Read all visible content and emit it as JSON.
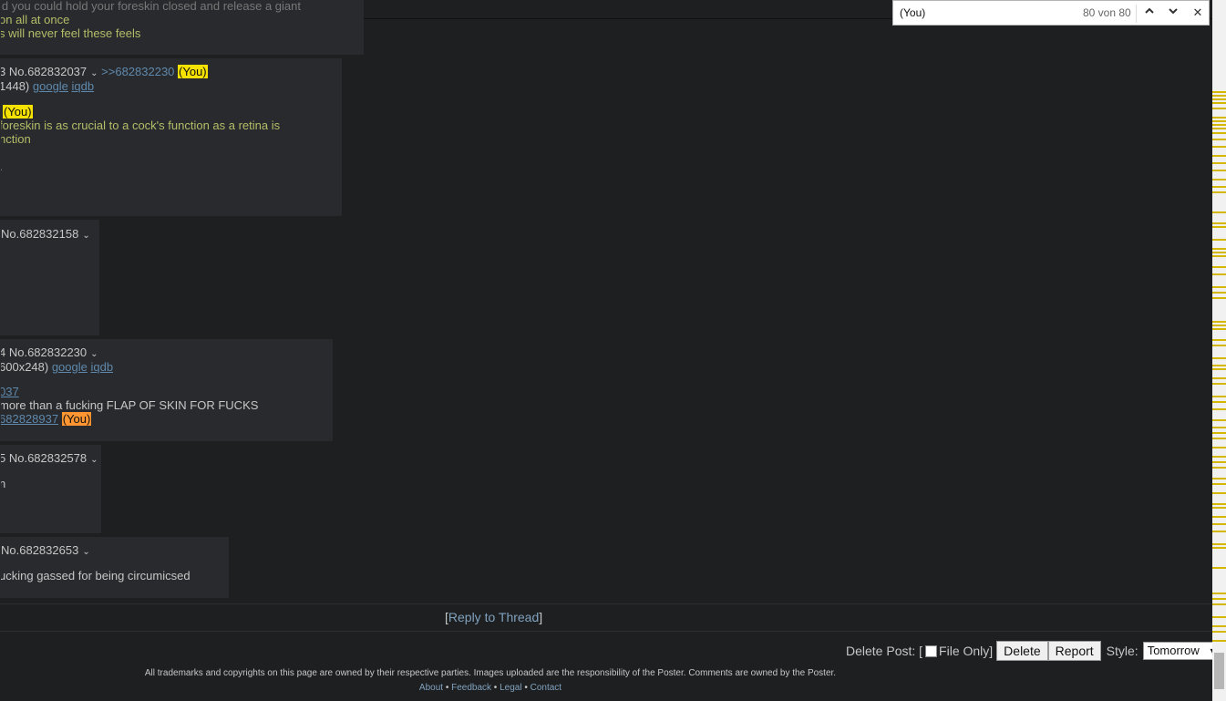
{
  "posts": [
    {
      "lines": [
        {
          "parts": [
            {
              "t": "ld you could hold your foreskin closed and release a giant",
              "c": "faded"
            }
          ]
        },
        {
          "parts": [
            {
              "t": "on all at once",
              "c": "quote"
            }
          ]
        },
        {
          "parts": [
            {
              "t": "s will never feel these feels",
              "c": "quote"
            }
          ]
        }
      ]
    },
    {
      "lines": [
        {
          "parts": [
            {
              "t": "3 No.682832037",
              "c": "num"
            },
            {
              "t": "⌄",
              "c": "arrow"
            },
            {
              "t": " >>682832230 ",
              "c": "ql"
            },
            {
              "t": "(You)",
              "c": "you-hl"
            }
          ]
        },
        {
          "parts": [
            {
              "t": "1448) ",
              "c": ""
            },
            {
              "t": "google",
              "c": "ul"
            },
            {
              "t": " ",
              "c": ""
            },
            {
              "t": "iqdb",
              "c": "ul"
            }
          ]
        },
        {
          "parts": [
            {
              "t": "(You)",
              "c": "you-hl"
            }
          ]
        },
        {
          "parts": [
            {
              "t": " foreskin is as crucial to a cock's function as a retina is",
              "c": "quote"
            }
          ]
        },
        {
          "parts": [
            {
              "t": "nction",
              "c": "quote"
            }
          ]
        },
        {
          "parts": [
            {
              "t": ".",
              "c": ""
            }
          ]
        }
      ]
    },
    {
      "lines": [
        {
          "parts": [
            {
              "t": " No.682832158",
              "c": "num"
            },
            {
              "t": "⌄",
              "c": "arrow"
            }
          ]
        }
      ]
    },
    {
      "lines": [
        {
          "parts": [
            {
              "t": "4 No.682832230",
              "c": "num"
            },
            {
              "t": "⌄",
              "c": "arrow"
            }
          ]
        },
        {
          "parts": [
            {
              "t": " 600x248) ",
              "c": ""
            },
            {
              "t": "google",
              "c": "ul"
            },
            {
              "t": " ",
              "c": ""
            },
            {
              "t": "iqdb",
              "c": "ul"
            }
          ]
        },
        {
          "parts": [
            {
              "t": "037",
              "c": "ul"
            }
          ]
        },
        {
          "parts": [
            {
              "t": "more than a fucking FLAP OF SKIN FOR FUCKS",
              "c": ""
            }
          ]
        },
        {
          "parts": [
            {
              "t": "682828937",
              "c": "ul"
            },
            {
              "t": " ",
              "c": ""
            },
            {
              "t": "(You)",
              "c": "you-cur"
            }
          ]
        }
      ]
    },
    {
      "lines": [
        {
          "parts": [
            {
              "t": "5 No.682832578",
              "c": "num"
            },
            {
              "t": "⌄",
              "c": "arrow"
            }
          ]
        },
        {
          "parts": [
            {
              "t": "n",
              "c": ""
            }
          ]
        }
      ]
    },
    {
      "lines": [
        {
          "parts": [
            {
              "t": " No.682832653",
              "c": "num"
            },
            {
              "t": "⌄",
              "c": "arrow"
            }
          ]
        },
        {
          "parts": [
            {
              "t": "ucking gassed for being circumicsed",
              "c": ""
            }
          ]
        }
      ]
    }
  ],
  "reply": {
    "open": "[",
    "link": "Reply to Thread",
    "close": "]"
  },
  "delete_form": {
    "label": "Delete Post: [",
    "file_only": "File Only]",
    "delete_btn": "Delete",
    "report_btn": "Report",
    "style_label": "Style:",
    "style_value": "Tomorrow"
  },
  "footer": {
    "disclaimer": "All trademarks and copyrights on this page are owned by their respective parties. Images uploaded are the responsibility of the Poster. Comments are owned by the Poster.",
    "links": [
      "About",
      "Feedback",
      "Legal",
      "Contact"
    ],
    "sep": " • "
  },
  "find_bar": {
    "query": "(You)",
    "count": "80 von 80",
    "icons": [
      "chevron-up-icon",
      "chevron-down-icon",
      "close-icon"
    ]
  },
  "colors": {
    "background": "#1d1f21",
    "post": "#282a2e",
    "link": "#81a2be",
    "greentext": "#b5bd68",
    "highlight": "#f6e200",
    "current_match": "#ff9632"
  }
}
